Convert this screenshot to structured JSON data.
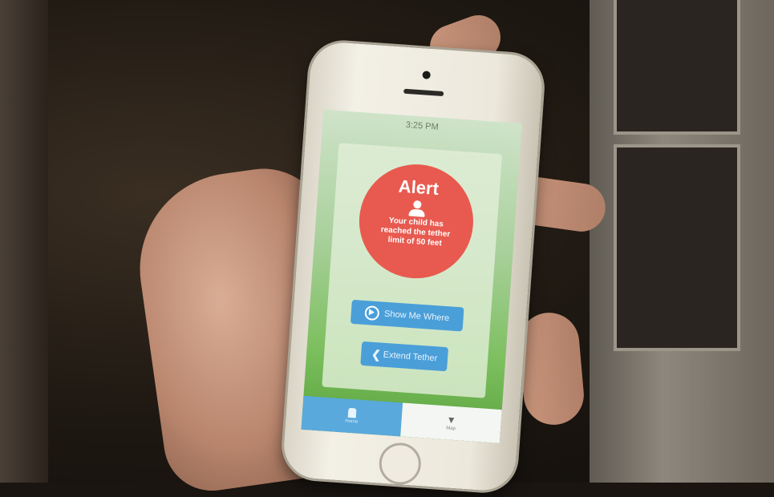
{
  "phone_app": {
    "status_bar": {
      "time": "3:25 PM"
    },
    "alert": {
      "title": "Alert",
      "message": "Your child has reached the tether limit of 50 feet"
    },
    "buttons": {
      "show_me_where": "Show Me Where",
      "extend_tether": "Extend Tether"
    },
    "tabs": [
      {
        "label": "Home",
        "icon": "home-icon",
        "active": true
      },
      {
        "label": "Map",
        "icon": "antenna-icon",
        "active": false
      }
    ]
  },
  "colors": {
    "alert_red": "#e85a4f",
    "button_blue": "#4a9fd9",
    "screen_green": "#7cbf5e"
  }
}
